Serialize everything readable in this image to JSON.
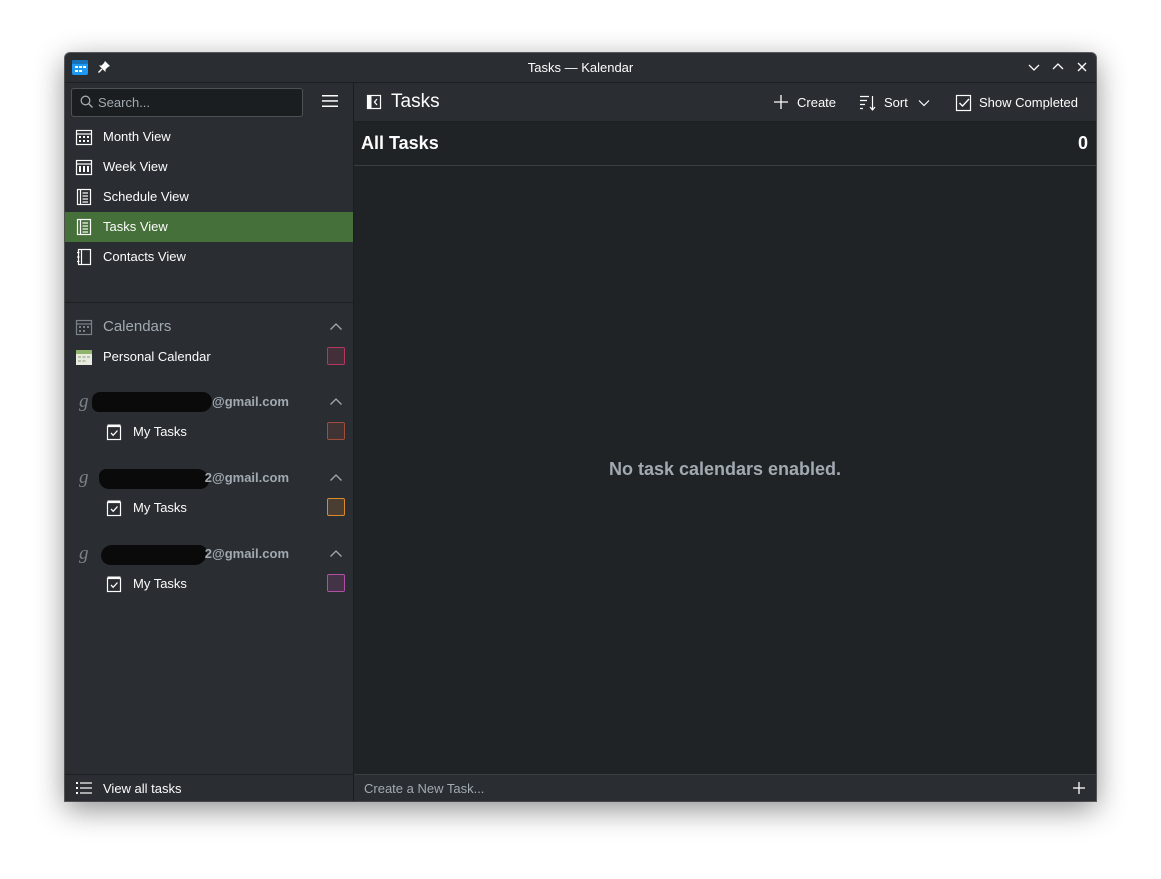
{
  "window": {
    "title": "Tasks — Kalendar"
  },
  "sidebar": {
    "search_placeholder": "Search...",
    "views": [
      {
        "label": "Month View",
        "icon": "calendar-month-icon"
      },
      {
        "label": "Week View",
        "icon": "calendar-week-icon"
      },
      {
        "label": "Schedule View",
        "icon": "schedule-icon"
      },
      {
        "label": "Tasks View",
        "icon": "tasks-icon",
        "active": true
      },
      {
        "label": "Contacts View",
        "icon": "contacts-icon"
      }
    ],
    "calendars_heading": "Calendars",
    "personal_calendar": {
      "label": "Personal Calendar",
      "color": "#b0385a"
    },
    "accounts": [
      {
        "email_visible": "@gmail.com",
        "task_list": "My Tasks",
        "color": "#a24d3a"
      },
      {
        "email_visible": "2@gmail.com",
        "task_list": "My Tasks",
        "color": "#d98a2b"
      },
      {
        "email_visible": "2@gmail.com",
        "task_list": "My Tasks",
        "color": "#b34ea6"
      }
    ],
    "footer_label": "View all tasks"
  },
  "main": {
    "page_title": "Tasks",
    "toolbar": {
      "create_label": "Create",
      "sort_label": "Sort",
      "show_completed_label": "Show Completed"
    },
    "list_title": "All Tasks",
    "task_count": "0",
    "empty_message": "No task calendars enabled.",
    "new_task_placeholder": "Create a New Task..."
  },
  "colors": {
    "accent_selected": "#46703a",
    "background": "#2a2e32",
    "content_background": "#202326"
  }
}
